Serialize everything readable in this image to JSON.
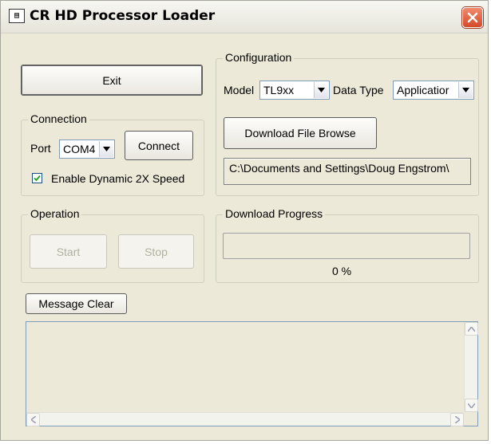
{
  "window": {
    "title": "CR HD Processor Loader",
    "app_icon": "loader-app-icon",
    "close_icon": "close-icon"
  },
  "exit_button": "Exit",
  "connection": {
    "legend": "Connection",
    "port_label": "Port",
    "port_value": "COM4",
    "connect_button": "Connect",
    "dynamic_speed_label": "Enable Dynamic 2X Speed",
    "dynamic_speed_checked": true
  },
  "operation": {
    "legend": "Operation",
    "start_button": "Start",
    "stop_button": "Stop"
  },
  "configuration": {
    "legend": "Configuration",
    "model_label": "Model",
    "model_value": "TL9xx",
    "data_type_label": "Data Type",
    "data_type_value": "Applicatior",
    "download_browse_button": "Download File Browse",
    "file_path": "C:\\Documents and Settings\\Doug Engstrom\\"
  },
  "download_progress": {
    "legend": "Download Progress",
    "percent": 0,
    "percent_text": "0 %"
  },
  "message_clear_button": "Message Clear",
  "message_log": "",
  "colors": {
    "close_button": "#d34a2a",
    "window_bg": "#ece9d8",
    "combo_border": "#7f9db9"
  }
}
